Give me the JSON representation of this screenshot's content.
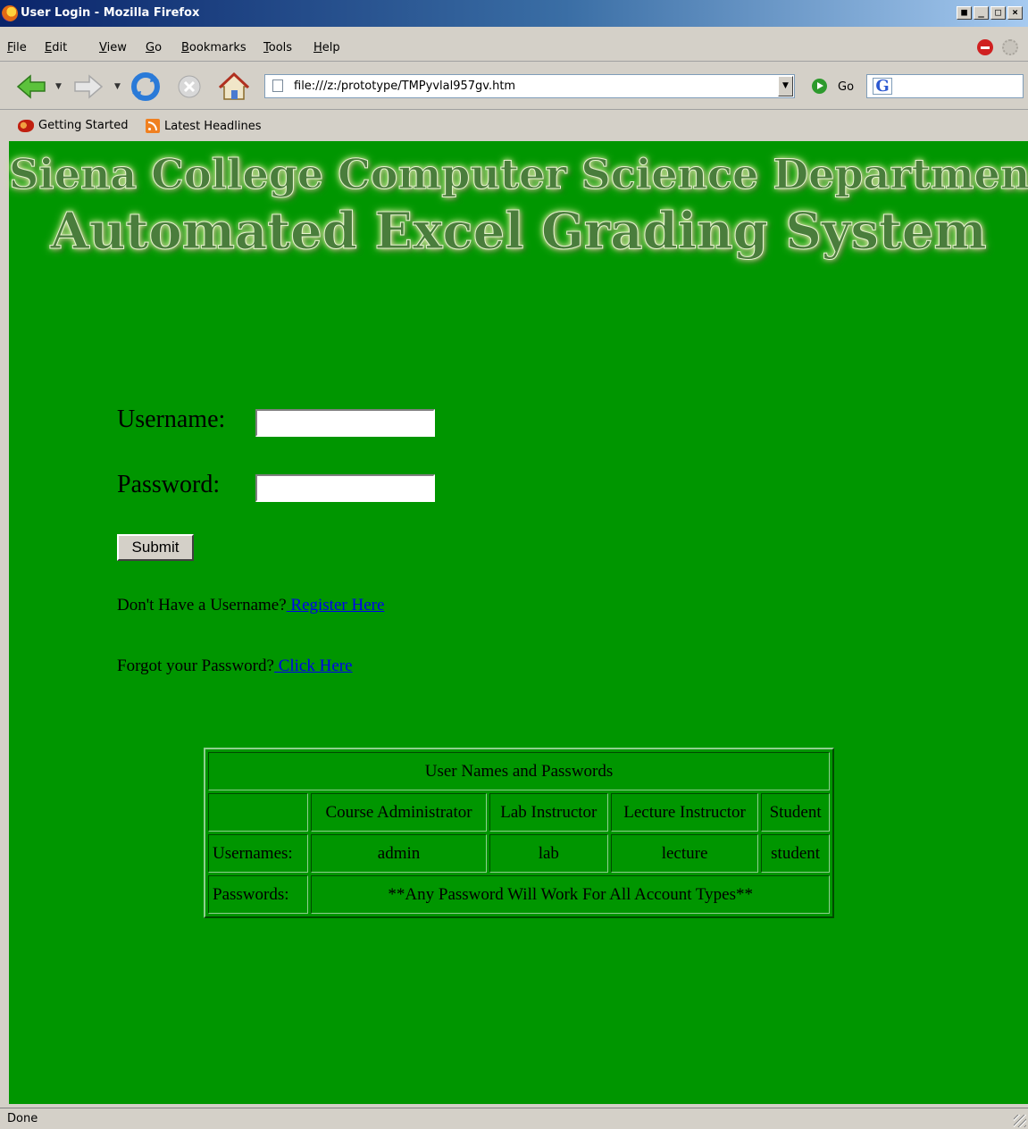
{
  "window": {
    "title": "User Login - Mozilla Firefox",
    "buttons": [
      "■",
      "_",
      "□",
      "×"
    ]
  },
  "menu": {
    "items": [
      {
        "label": "File",
        "accel": "F",
        "rest": "ile"
      },
      {
        "label": "Edit",
        "accel": "E",
        "rest": "dit"
      },
      {
        "label": "View",
        "accel": "V",
        "rest": "iew"
      },
      {
        "label": "Go",
        "accel": "G",
        "rest": "o"
      },
      {
        "label": "Bookmarks",
        "accel": "B",
        "rest": "ookmarks"
      },
      {
        "label": "Tools",
        "accel": "T",
        "rest": "ools"
      },
      {
        "label": "Help",
        "accel": "H",
        "rest": "elp"
      }
    ]
  },
  "navbar": {
    "url": "file:///z:/prototype/TMPyvlal957gv.htm",
    "go_label": "Go",
    "search_engine_icon": "G"
  },
  "bookmarks": {
    "items": [
      "Getting Started",
      "Latest Headlines"
    ]
  },
  "page": {
    "banner_line1": "Siena College Computer Science Department",
    "banner_line2": "Automated Excel Grading System",
    "username_label": "Username:",
    "password_label": "Password:",
    "username_value": "",
    "password_value": "",
    "submit_label": "Submit",
    "register_prompt": "Don't Have a Username?",
    "register_link": " Register Here",
    "forgot_prompt": "Forgot your Password?",
    "forgot_link": " Click Here",
    "table": {
      "caption": "User Names and Passwords",
      "headers": [
        "Course Administrator",
        "Lab Instructor",
        "Lecture Instructor",
        "Student"
      ],
      "usernames_label": "Usernames:",
      "usernames": [
        "admin",
        "lab",
        "lecture",
        "student"
      ],
      "passwords_label": "Passwords:",
      "passwords_note": "**Any Password Will Work For All Account Types**"
    }
  },
  "status": {
    "text": "Done"
  },
  "colors": {
    "page_background": "#009600",
    "link": "#0000ee",
    "chrome": "#d4d0c8"
  }
}
